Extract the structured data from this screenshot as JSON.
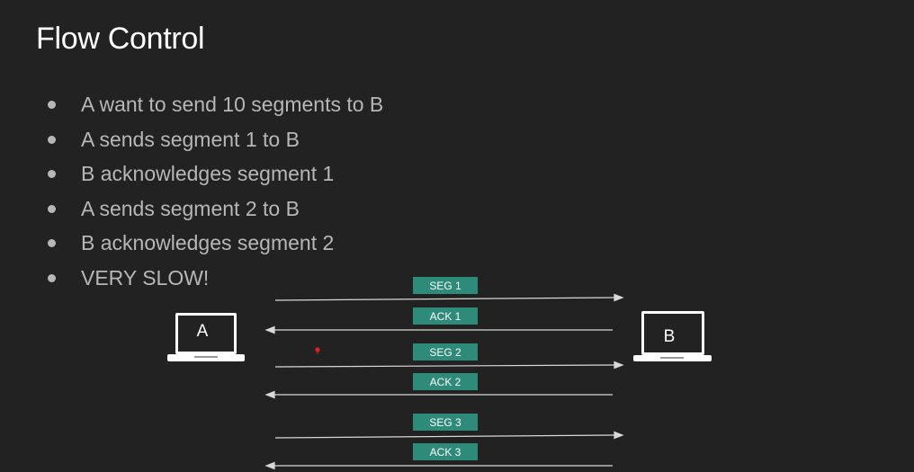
{
  "slide": {
    "title": "Flow Control",
    "bullets": [
      "A want to send 10 segments to B",
      "A sends segment 1 to B",
      "B acknowledges segment 1",
      "A sends segment 2 to B",
      "B acknowledges segment 2",
      "VERY SLOW!"
    ]
  },
  "diagram": {
    "host_a": "A",
    "host_b": "B",
    "messages": [
      {
        "label": "SEG 1",
        "direction": "A-to-B"
      },
      {
        "label": "ACK 1",
        "direction": "B-to-A"
      },
      {
        "label": "SEG 2",
        "direction": "A-to-B"
      },
      {
        "label": "ACK 2",
        "direction": "B-to-A"
      },
      {
        "label": "SEG 3",
        "direction": "A-to-B"
      },
      {
        "label": "ACK 3",
        "direction": "B-to-A"
      }
    ]
  },
  "colors": {
    "background": "#222222",
    "title": "#ffffff",
    "bullet_text": "#b7b7b7",
    "label_box": "#2e8b79",
    "arrow": "#d9d9d9",
    "pointer_dot": "#e02020"
  }
}
